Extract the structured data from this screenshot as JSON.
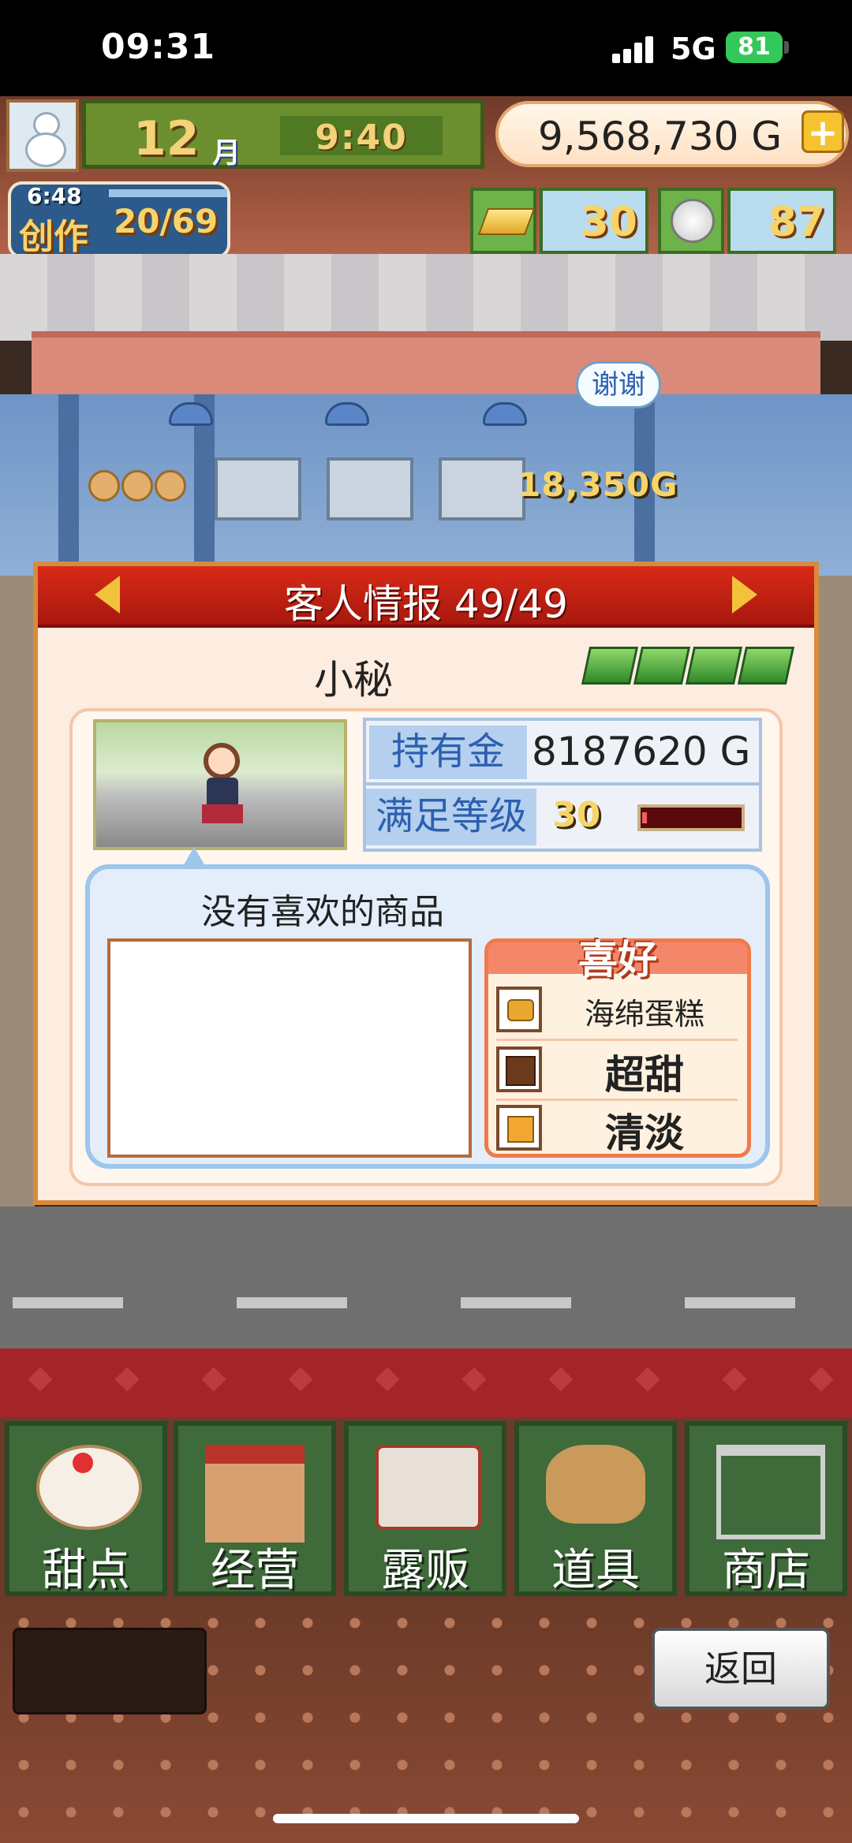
{
  "status_bar": {
    "time": "09:31",
    "network": "5G",
    "battery": "81"
  },
  "hud": {
    "month_number": "12",
    "month_label": "月",
    "clock": "9:40",
    "gold": "9,568,730 G",
    "plus": "+",
    "create_timer": "6:48",
    "create_label": "创作",
    "create_count": "20/69",
    "gold_bars": "30",
    "coins": "87"
  },
  "scene": {
    "thanks": "谢谢",
    "sale": "18,350G"
  },
  "dialog": {
    "title": "客人情报 49/49",
    "customer_name": "小秘",
    "money_label": "持有金",
    "money_value": "8187620 G",
    "level_label": "满足等级",
    "level_value": "30",
    "level_fill_fraction": 0.05,
    "no_like_text": "没有喜欢的商品",
    "prefs_title": "喜好",
    "prefs": [
      {
        "icon": "sponge-cake-icon",
        "text": "海绵蛋糕"
      },
      {
        "icon": "chocolate-icon",
        "text": "超甜"
      },
      {
        "icon": "cube-icon",
        "text": "清淡"
      }
    ]
  },
  "nav": [
    {
      "label": "甜点",
      "icon": "cake-icon"
    },
    {
      "label": "经营",
      "icon": "shop-icon"
    },
    {
      "label": "露贩",
      "icon": "truck-icon"
    },
    {
      "label": "道具",
      "icon": "gear-bag-icon"
    },
    {
      "label": "商店",
      "icon": "cart-icon"
    }
  ],
  "back_label": "返回",
  "colors": {
    "header_red": "#c8200f",
    "label_blue": "#2d5fb0",
    "nav_green": "#3f6a3a"
  }
}
